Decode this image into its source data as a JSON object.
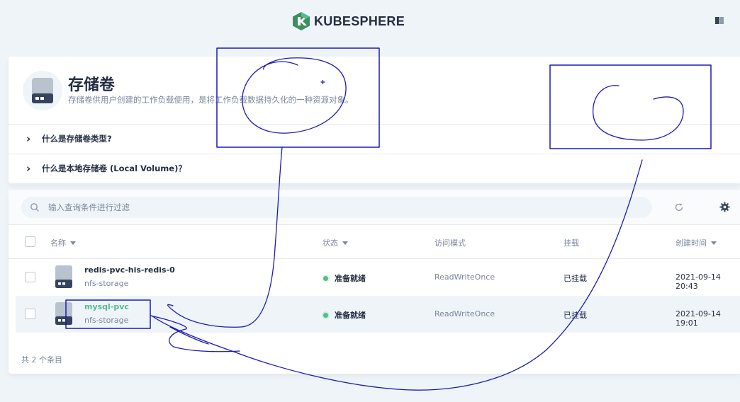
{
  "header": {
    "brand": "KUBESPHERE"
  },
  "banner": {
    "title": "存储卷",
    "description": "存储卷供用户创建的工作负载使用，是将工作负载数据持久化的一种资源对象。",
    "faqs": [
      {
        "label": "什么是存储卷类型?"
      },
      {
        "label": "什么是本地存储卷 (Local Volume)？"
      }
    ]
  },
  "search": {
    "placeholder": "输入查询条件进行过滤"
  },
  "table": {
    "columns": {
      "name": "名称",
      "status": "状态",
      "access": "访问模式",
      "mount": "挂载",
      "created": "创建时间"
    },
    "rows": [
      {
        "name": "redis-pvc-his-redis-0",
        "storage_class": "nfs-storage",
        "status": "准备就绪",
        "access_mode": "ReadWriteOnce",
        "mount": "已挂载",
        "created": "2021-09-14 20:43"
      },
      {
        "name": "mysql-pvc",
        "storage_class": "nfs-storage",
        "status": "准备就绪",
        "access_mode": "ReadWriteOnce",
        "mount": "已挂载",
        "created": "2021-09-14 19:01"
      }
    ],
    "total_label": "共 2 个条目"
  },
  "icons": {
    "logo": "kubesphere-logo-icon",
    "layout": "layout-toggle-icon",
    "volume": "disk-icon",
    "search": "search-icon",
    "refresh": "refresh-icon",
    "settings": "gear-icon",
    "chevron": "chevron-right-icon"
  },
  "colors": {
    "accent": "#55bc8a",
    "text": "#242e42",
    "muted": "#79879c",
    "background": "#eff4f9",
    "annotation": "#1a1ab8"
  }
}
